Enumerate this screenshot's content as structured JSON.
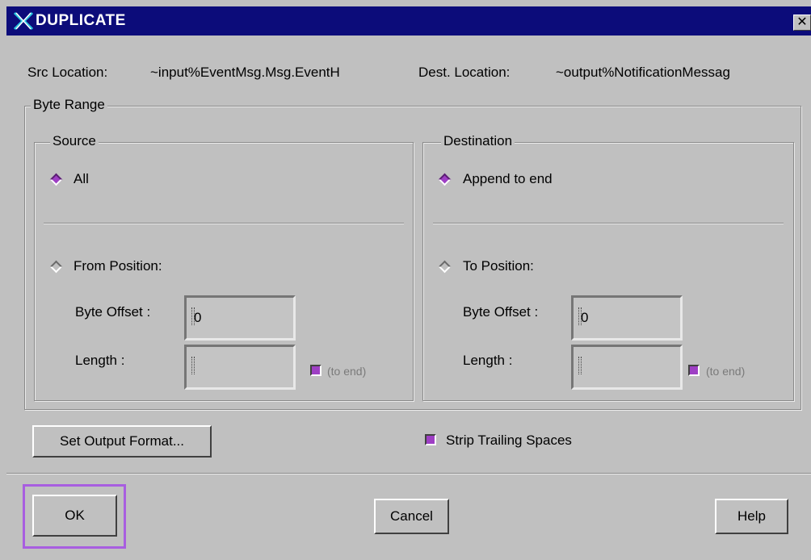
{
  "window": {
    "title": "DUPLICATE",
    "close_glyph": "✕"
  },
  "locations": {
    "src_label": "Src Location:",
    "src_value": "~input%EventMsg.Msg.EventH",
    "dest_label": "Dest. Location:",
    "dest_value": "~output%NotificationMessag"
  },
  "byte_range": {
    "legend": "Byte Range",
    "source": {
      "legend": "Source",
      "all_label": "All",
      "all_selected": true,
      "from_label": "From Position:",
      "byte_offset_label": "Byte Offset :",
      "byte_offset_value": "0",
      "length_label": "Length :",
      "length_value": "",
      "to_end_label": "(to end)",
      "to_end_checked": true
    },
    "destination": {
      "legend": "Destination",
      "append_label": "Append to end",
      "append_selected": true,
      "to_label": "To Position:",
      "byte_offset_label": "Byte Offset :",
      "byte_offset_value": "0",
      "length_label": "Length :",
      "length_value": "",
      "to_end_label": "(to end)",
      "to_end_checked": true
    }
  },
  "options": {
    "set_output_format_label": "Set Output Format...",
    "strip_trailing_label": "Strip Trailing Spaces",
    "strip_trailing_checked": true
  },
  "buttons": {
    "ok": "OK",
    "cancel": "Cancel",
    "help": "Help"
  },
  "colors": {
    "titlebar": "#0c0c7a",
    "accent": "#9e3fc4",
    "background": "#c0c0c0"
  }
}
